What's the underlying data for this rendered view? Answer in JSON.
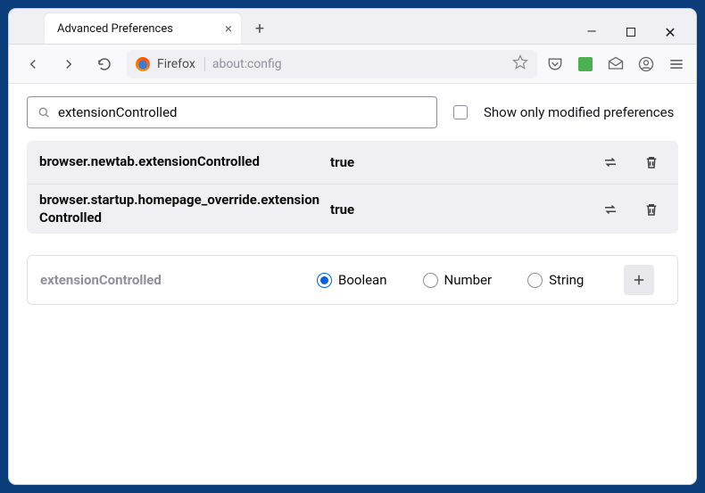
{
  "tab": {
    "title": "Advanced Preferences"
  },
  "urlbar": {
    "host_label": "Firefox",
    "path": "about:config"
  },
  "search": {
    "value": "extensionControlled"
  },
  "checkbox": {
    "label": "Show only modified preferences"
  },
  "prefs": [
    {
      "name": "browser.newtab.extensionControlled",
      "value": "true"
    },
    {
      "name": "browser.startup.homepage_override.extensionControlled",
      "value": "true"
    }
  ],
  "add": {
    "name": "extensionControlled",
    "types": [
      "Boolean",
      "Number",
      "String"
    ],
    "selected": "Boolean"
  }
}
